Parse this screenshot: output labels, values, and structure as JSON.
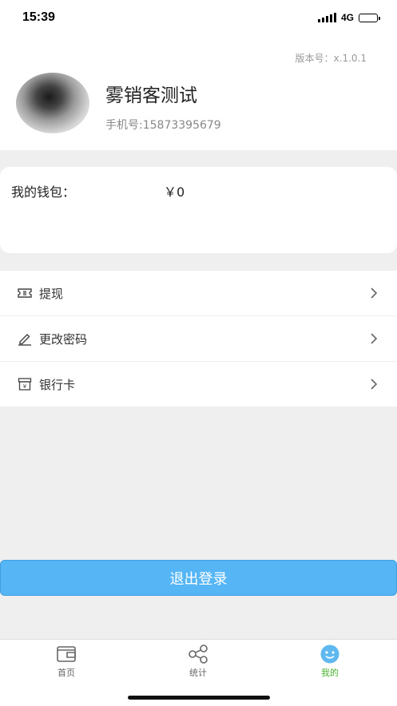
{
  "status_bar": {
    "time": "15:39",
    "network": "4G"
  },
  "profile": {
    "version": "版本号：x.1.0.1",
    "name": "雾销客测试",
    "phone": "手机号:15873395679"
  },
  "wallet": {
    "label": "我的钱包：",
    "value": "￥0"
  },
  "menu": [
    {
      "label": "提现",
      "icon": "ticket-icon"
    },
    {
      "label": "更改密码",
      "icon": "pencil-icon"
    },
    {
      "label": "银行卡",
      "icon": "bank-card-icon"
    }
  ],
  "logout_label": "退出登录",
  "tabs": [
    {
      "label": "首页",
      "icon": "wallet-icon",
      "active": false
    },
    {
      "label": "统计",
      "icon": "share-nodes-icon",
      "active": false
    },
    {
      "label": "我的",
      "icon": "face-icon",
      "active": true
    }
  ],
  "colors": {
    "accent": "#56b6f5",
    "active_tab": "#46b52d"
  }
}
